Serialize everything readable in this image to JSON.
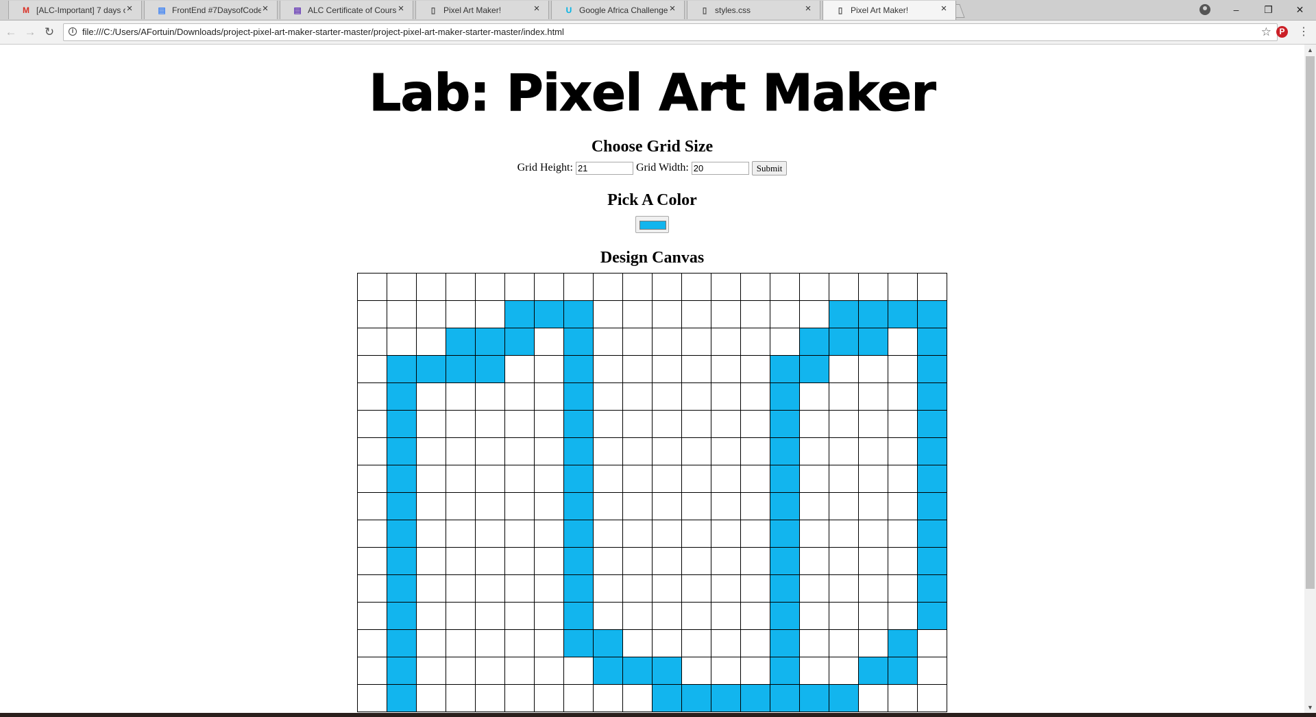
{
  "browser": {
    "tabs": [
      {
        "title": "[ALC-Important] 7 days o",
        "icon": "gmail-icon",
        "active": false
      },
      {
        "title": "FrontEnd #7DaysofCode(",
        "icon": "docs-icon",
        "active": false
      },
      {
        "title": "ALC Certificate of Course",
        "icon": "forms-icon",
        "active": false
      },
      {
        "title": "Pixel Art Maker!",
        "icon": "page-icon",
        "active": false
      },
      {
        "title": "Google Africa Challenge",
        "icon": "udacity-icon",
        "active": false
      },
      {
        "title": "styles.css",
        "icon": "page-icon",
        "active": false
      },
      {
        "title": "Pixel Art Maker!",
        "icon": "page-icon",
        "active": true
      }
    ],
    "url": "file:///C:/Users/AFortuin/Downloads/project-pixel-art-maker-starter-master/project-pixel-art-maker-starter-master/index.html",
    "window_controls": {
      "minimize": "–",
      "restore": "❐",
      "close": "✕"
    }
  },
  "page": {
    "title": "Lab: Pixel Art Maker",
    "grid_heading": "Choose Grid Size",
    "height_label": "Grid Height:",
    "height_value": "21",
    "width_label": "Grid Width:",
    "width_value": "20",
    "submit_label": "Submit",
    "color_heading": "Pick A Color",
    "color_value": "#12b5ee",
    "canvas_heading": "Design Canvas"
  },
  "canvas": {
    "visible_rows": 16,
    "columns": 20,
    "fill_color": "#12b5ee",
    "filled_cells": [
      [
        1,
        5
      ],
      [
        1,
        6
      ],
      [
        1,
        7
      ],
      [
        1,
        16
      ],
      [
        1,
        17
      ],
      [
        1,
        18
      ],
      [
        1,
        19
      ],
      [
        2,
        3
      ],
      [
        2,
        4
      ],
      [
        2,
        5
      ],
      [
        2,
        7
      ],
      [
        2,
        15
      ],
      [
        2,
        16
      ],
      [
        2,
        17
      ],
      [
        2,
        19
      ],
      [
        3,
        1
      ],
      [
        3,
        2
      ],
      [
        3,
        3
      ],
      [
        3,
        4
      ],
      [
        3,
        7
      ],
      [
        3,
        14
      ],
      [
        3,
        15
      ],
      [
        3,
        19
      ],
      [
        4,
        1
      ],
      [
        4,
        7
      ],
      [
        4,
        14
      ],
      [
        4,
        19
      ],
      [
        5,
        1
      ],
      [
        5,
        7
      ],
      [
        5,
        14
      ],
      [
        5,
        19
      ],
      [
        6,
        1
      ],
      [
        6,
        7
      ],
      [
        6,
        14
      ],
      [
        6,
        19
      ],
      [
        7,
        1
      ],
      [
        7,
        7
      ],
      [
        7,
        14
      ],
      [
        7,
        19
      ],
      [
        8,
        1
      ],
      [
        8,
        7
      ],
      [
        8,
        14
      ],
      [
        8,
        19
      ],
      [
        9,
        1
      ],
      [
        9,
        7
      ],
      [
        9,
        14
      ],
      [
        9,
        19
      ],
      [
        10,
        1
      ],
      [
        10,
        7
      ],
      [
        10,
        14
      ],
      [
        10,
        19
      ],
      [
        11,
        1
      ],
      [
        11,
        7
      ],
      [
        11,
        14
      ],
      [
        11,
        19
      ],
      [
        12,
        1
      ],
      [
        12,
        7
      ],
      [
        12,
        14
      ],
      [
        12,
        19
      ],
      [
        13,
        1
      ],
      [
        13,
        7
      ],
      [
        13,
        8
      ],
      [
        13,
        14
      ],
      [
        13,
        18
      ],
      [
        14,
        1
      ],
      [
        14,
        8
      ],
      [
        14,
        9
      ],
      [
        14,
        10
      ],
      [
        14,
        14
      ],
      [
        14,
        17
      ],
      [
        14,
        18
      ],
      [
        15,
        1
      ],
      [
        15,
        10
      ],
      [
        15,
        11
      ],
      [
        15,
        12
      ],
      [
        15,
        13
      ],
      [
        15,
        14
      ],
      [
        15,
        15
      ],
      [
        15,
        16
      ]
    ]
  }
}
